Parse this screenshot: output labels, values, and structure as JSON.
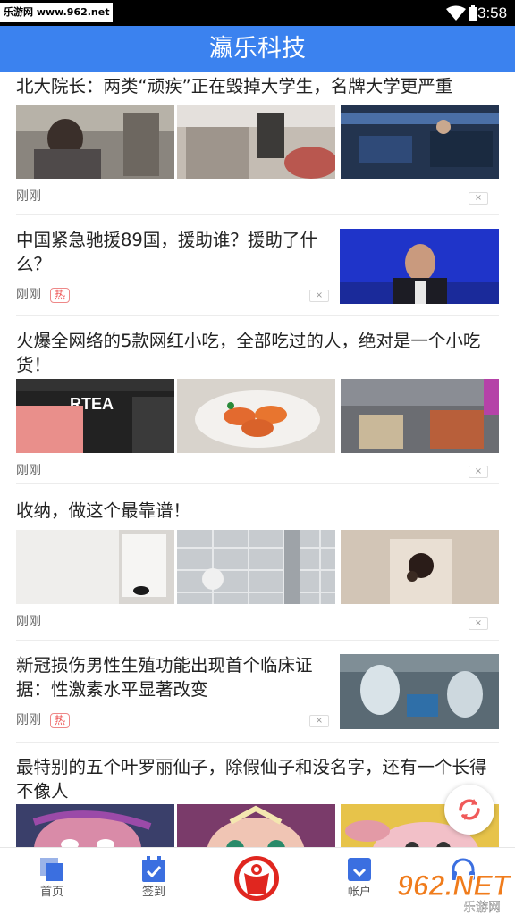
{
  "status_bar": {
    "watermark": "乐游网 www.962.net",
    "time": "3:58",
    "icons": [
      "wifi-icon",
      "battery-icon"
    ]
  },
  "app": {
    "title": "瀛乐科技",
    "accent_color": "#3b82ef"
  },
  "feed": {
    "items": [
      {
        "headline": "北大院长：两类“顽疾”正在毁掉大学生，名牌大学更严重",
        "time": "刚刚",
        "tag": "",
        "close": "×",
        "layout": "three-images"
      },
      {
        "headline": "中国紧急驰援89国，援助谁？援助了什么？",
        "time": "刚刚",
        "tag": "热",
        "close": "×",
        "layout": "right-image"
      },
      {
        "headline": "火爆全网络的5款网红小吃，全部吃过的人，绝对是一个小吃货！",
        "time": "刚刚",
        "tag": "",
        "close": "×",
        "layout": "three-images",
        "image_text": "RTEA"
      },
      {
        "headline": "收纳，做这个最靠谱！",
        "time": "刚刚",
        "tag": "",
        "close": "×",
        "layout": "three-images"
      },
      {
        "headline": "新冠损伤男性生殖功能出现首个临床证据：性激素水平显著改变",
        "time": "刚刚",
        "tag": "热",
        "close": "×",
        "layout": "right-image"
      },
      {
        "headline": "最特别的五个叶罗丽仙子，除假仙子和没名字，还有一个长得不像人",
        "time": "",
        "tag": "",
        "close": "",
        "layout": "three-images"
      }
    ]
  },
  "refresh_button": {
    "icon": "refresh-icon"
  },
  "bottom_nav": {
    "items": [
      {
        "label": "首页",
        "icon": "home-icon"
      },
      {
        "label": "签到",
        "icon": "checkin-icon"
      },
      {
        "label": "",
        "icon": "center-logo-icon"
      },
      {
        "label": "帐户",
        "icon": "account-icon"
      },
      {
        "label": "",
        "icon": "headset-icon"
      }
    ]
  },
  "watermark_bottom": {
    "line1": "962.NET",
    "line2": "乐游网"
  }
}
